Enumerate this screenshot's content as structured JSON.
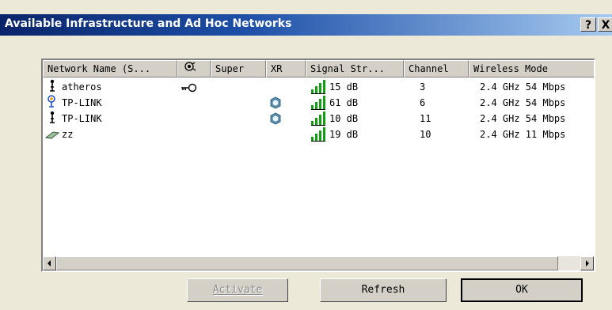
{
  "window": {
    "title": "Available Infrastructure and Ad Hoc Networks",
    "help_label": "?",
    "close_label": "X"
  },
  "table": {
    "columns": [
      "Network Name (S...",
      "",
      "Super",
      "XR",
      "Signal Str...",
      "Channel",
      "Wireless Mode"
    ],
    "key_column_icon": "key-icon",
    "rows": [
      {
        "type_icon": "infrastructure-antenna-icon",
        "name": "atheros",
        "secured": true,
        "xr": false,
        "signal": "15 dB",
        "channel": "3",
        "mode": "2.4 GHz 54 Mbps"
      },
      {
        "type_icon": "connected-antenna-icon",
        "name": "TP-LINK",
        "secured": false,
        "xr": true,
        "signal": "61 dB",
        "channel": "6",
        "mode": "2.4 GHz 54 Mbps"
      },
      {
        "type_icon": "infrastructure-antenna-icon",
        "name": "TP-LINK",
        "secured": false,
        "xr": true,
        "signal": "10 dB",
        "channel": "11",
        "mode": "2.4 GHz 54 Mbps"
      },
      {
        "type_icon": "adhoc-network-icon",
        "name": "zz",
        "secured": false,
        "xr": false,
        "signal": "19 dB",
        "channel": "10",
        "mode": "2.4 GHz 11 Mbps"
      }
    ]
  },
  "buttons": {
    "activate": "Activate",
    "refresh": "Refresh",
    "ok": "OK"
  },
  "colors": {
    "signal_bars": "#11a011",
    "titlebar_start": "#0a246a",
    "titlebar_end": "#a6caf0",
    "dialog_bg": "#ece9d8"
  }
}
